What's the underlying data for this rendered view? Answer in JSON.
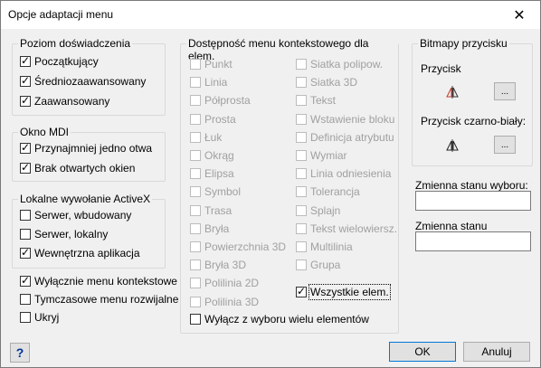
{
  "window": {
    "title": "Opcje adaptacji menu",
    "close_glyph": "✕"
  },
  "experience": {
    "legend": "Poziom doświadczenia",
    "items": [
      {
        "label": "Początkujący",
        "checked": true
      },
      {
        "label": "Średniozaawansowany",
        "checked": true
      },
      {
        "label": "Zaawansowany",
        "checked": true
      }
    ]
  },
  "mdi": {
    "legend": "Okno MDI",
    "items": [
      {
        "label": "Przynajmniej jedno otwa",
        "checked": true
      },
      {
        "label": "Brak otwartych okien",
        "checked": true
      }
    ]
  },
  "activex": {
    "legend": "Lokalne wywołanie ActiveX",
    "items": [
      {
        "label": "Serwer, wbudowany",
        "checked": false
      },
      {
        "label": "Serwer, lokalny",
        "checked": false
      },
      {
        "label": "Wewnętrzna aplikacja",
        "checked": true
      }
    ]
  },
  "extra": [
    {
      "label": "Wyłącznie menu kontekstowe",
      "checked": true
    },
    {
      "label": "Tymczasowe menu rozwijalne",
      "checked": false
    },
    {
      "label": "Ukryj",
      "checked": false
    }
  ],
  "context": {
    "legend": "Dostępność menu kontekstowego dla elem.",
    "col1": [
      "Punkt",
      "Linia",
      "Półprosta",
      "Prosta",
      "Łuk",
      "Okrąg",
      "Elipsa",
      "Symbol",
      "Trasa",
      "Bryła",
      "Powierzchnia 3D",
      "Bryła 3D",
      "Polilinia 2D",
      "Polilinia 3D"
    ],
    "col2": [
      "Siatka polipow.",
      "Siatka 3D",
      "Tekst",
      "Wstawienie bloku",
      "Definicja atrybutu",
      "Wymiar",
      "Linia odniesienia",
      "Tolerancja",
      "Splajn",
      "Tekst wielowiersz.",
      "Multilinia",
      "Grupa"
    ],
    "all_label": "Wszystkie elem.",
    "all_checked": true,
    "exclude_label": "Wyłącz z wyboru wielu elementów",
    "exclude_checked": false
  },
  "bitmaps": {
    "legend": "Bitmapy przycisku",
    "button_label": "Przycisk",
    "bw_label": "Przycisk czarno-biały:",
    "browse": "..."
  },
  "selection_var": {
    "label": "Zmienna stanu wyboru:",
    "value": ""
  },
  "state_var": {
    "label": "Zmienna stanu",
    "value": ""
  },
  "buttons": {
    "ok": "OK",
    "cancel": "Anuluj",
    "help": "?"
  }
}
